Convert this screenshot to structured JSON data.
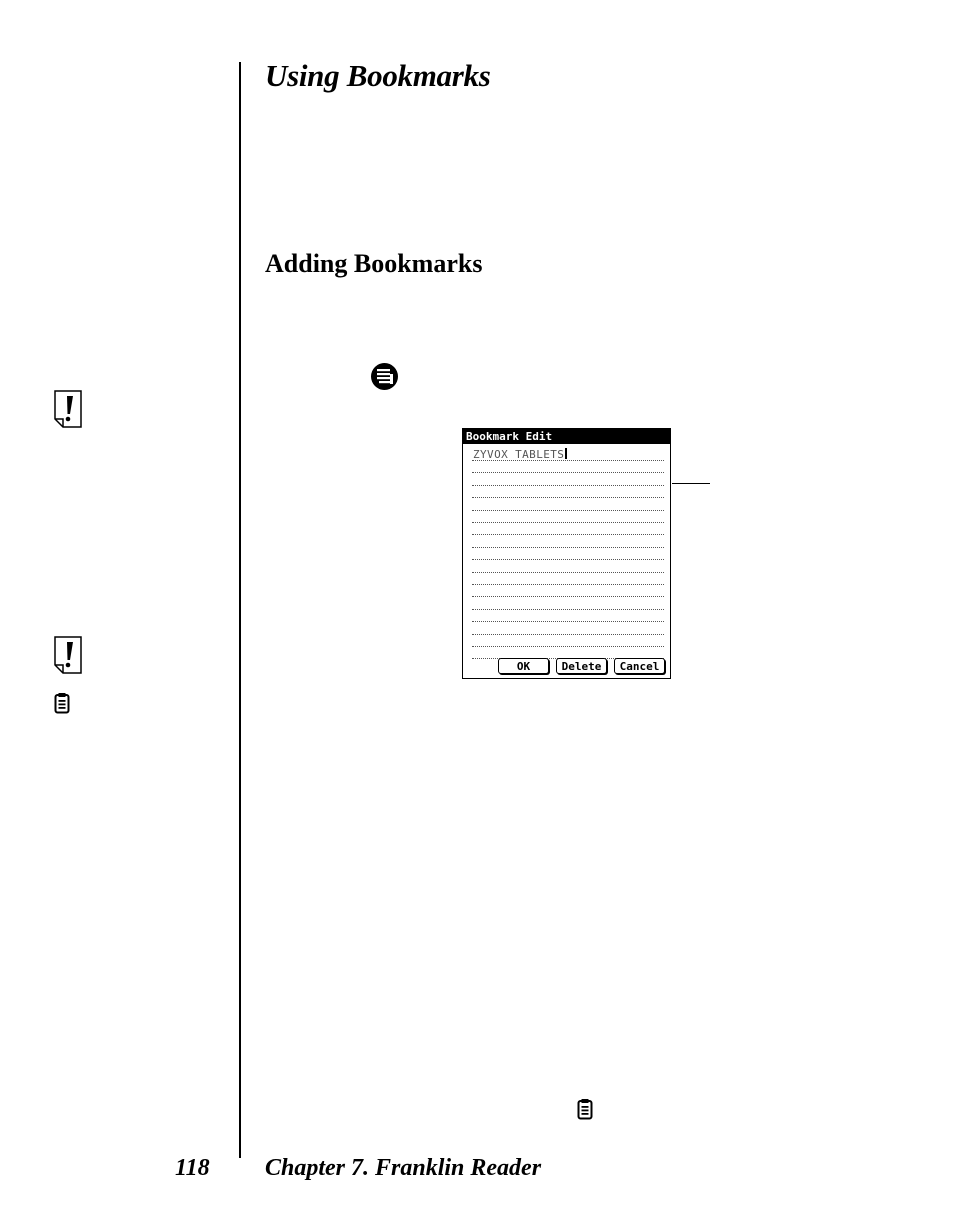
{
  "heading": "Using Bookmarks",
  "subheading": "Adding Bookmarks",
  "footer": {
    "page_number": "118",
    "chapter": "Chapter 7. Franklin Reader"
  },
  "icons": {
    "menu": "menu-icon",
    "note": "exclamation-note-icon",
    "clipboard": "clipboard-icon"
  },
  "dialog": {
    "title": "Bookmark Edit",
    "text_value": "ZYVOX TABLETS",
    "buttons": {
      "ok": "OK",
      "delete": "Delete",
      "cancel": "Cancel"
    }
  },
  "colors": {
    "ink": "#000000",
    "paper": "#ffffff",
    "dialog_text": "#555555"
  }
}
